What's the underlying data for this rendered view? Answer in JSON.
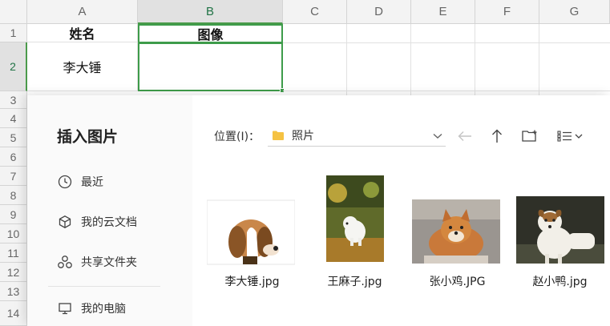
{
  "sheet": {
    "columns": [
      "A",
      "B",
      "C",
      "D",
      "E",
      "F",
      "G"
    ],
    "rows": [
      "1",
      "2",
      "3",
      "4",
      "5",
      "6",
      "7",
      "8",
      "9",
      "10",
      "11",
      "12",
      "13",
      "14"
    ],
    "cells": {
      "a1": "姓名",
      "b1": "图像",
      "a2": "李大锤",
      "b2": ""
    },
    "selected_column": "B",
    "selected_row": "2"
  },
  "dialog": {
    "title": "插入图片",
    "nav": [
      {
        "label": "最近",
        "icon": "clock-icon"
      },
      {
        "label": "我的云文档",
        "icon": "cube-icon"
      },
      {
        "label": "共享文件夹",
        "icon": "share-icon"
      },
      {
        "label": "我的电脑",
        "icon": "monitor-icon"
      }
    ],
    "location_label": "位置(I)：",
    "location_value": "照片",
    "files": [
      {
        "name": "李大锤.jpg"
      },
      {
        "name": "王麻子.jpg"
      },
      {
        "name": "张小鸡.JPG"
      },
      {
        "name": "赵小鸭.jpg"
      }
    ]
  },
  "colors": {
    "accent": "#3e9c4a",
    "folder": "#f5c242"
  }
}
